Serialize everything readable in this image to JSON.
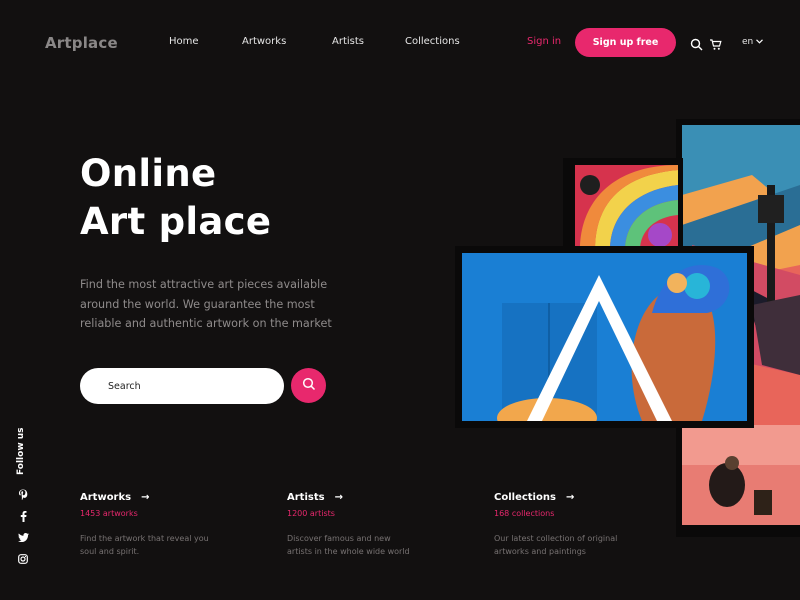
{
  "header": {
    "logo": "Artplace",
    "nav": [
      "Home",
      "Artworks",
      "Artists",
      "Collections"
    ],
    "signin": "Sign in",
    "signup": "Sign up free",
    "lang": "en"
  },
  "hero": {
    "title_line1": "Online",
    "title_line2": "Art place",
    "desc": "Find the most attractive art pieces available around the world. We guarantee the most reliable and authentic artwork on the market",
    "search_placeholder": "Search"
  },
  "social": {
    "label": "Follow us",
    "icons": [
      "pinterest-icon",
      "facebook-icon",
      "twitter-icon",
      "instagram-icon"
    ]
  },
  "stats": [
    {
      "title": "Artworks",
      "count": "1453 artworks",
      "desc": "Find the artwork that reveal you soul and spirit."
    },
    {
      "title": "Artists",
      "count": "1200 artists",
      "desc": "Discover famous and new artists in the whole wide world"
    },
    {
      "title": "Collections",
      "count": "168 collections",
      "desc": "Our latest collection of original artworks and paintings"
    }
  ],
  "colors": {
    "accent": "#e8286d",
    "background": "#121010"
  }
}
